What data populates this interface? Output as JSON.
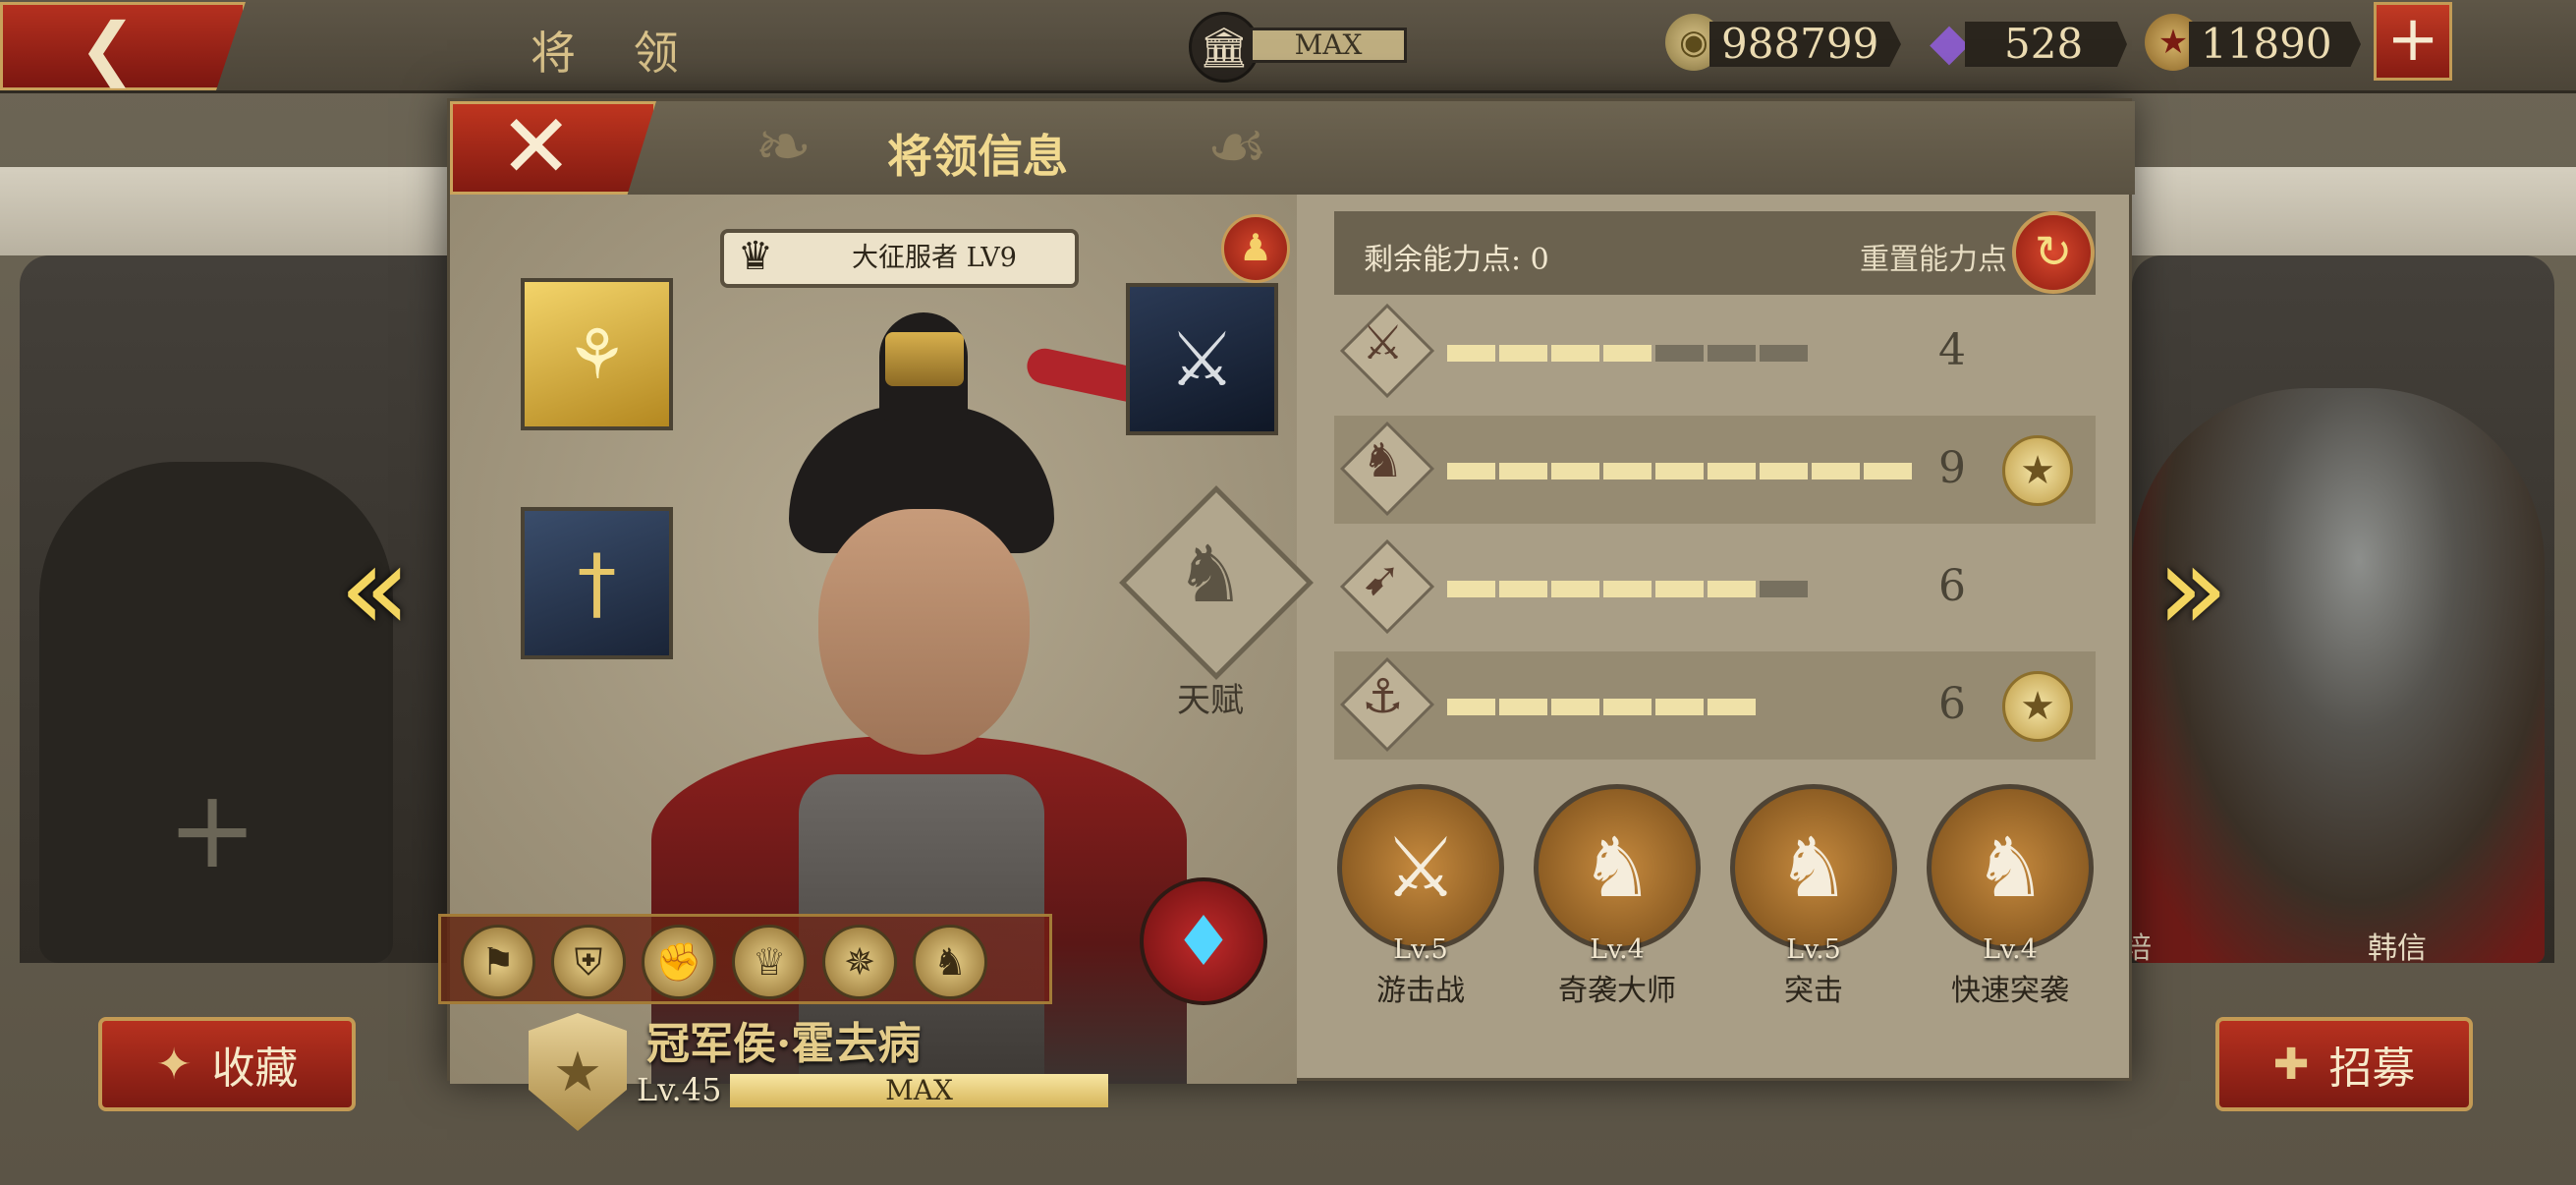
{
  "topbar": {
    "title": "将 领",
    "max_label": "MAX",
    "silver": "988799",
    "gems": "528",
    "tickets": "11890"
  },
  "modal": {
    "title": "将领信息",
    "rank_badge": "大征服者 LV9",
    "talent_label": "天赋",
    "hero_name": "冠军侯·霍去病",
    "level": "Lv.45",
    "level_bar": "MAX",
    "level_progress": 1.0
  },
  "stats": {
    "remaining_label": "剩余能力点: 0",
    "reset_label": "重置能力点",
    "rows": [
      {
        "icon": "sword-icon",
        "value": "4",
        "filled": 4,
        "total": 7,
        "medal": false
      },
      {
        "icon": "horse-icon",
        "value": "9",
        "filled": 9,
        "total": 9,
        "medal": true
      },
      {
        "icon": "bow-icon",
        "value": "6",
        "filled": 6,
        "total": 7,
        "medal": false
      },
      {
        "icon": "anchor-icon",
        "value": "6",
        "filled": 6,
        "total": 6,
        "medal": true
      }
    ]
  },
  "skills": [
    {
      "level": "Lv.5",
      "name": "游击战"
    },
    {
      "level": "Lv.4",
      "name": "奇袭大师"
    },
    {
      "level": "Lv.5",
      "name": "突击"
    },
    {
      "level": "Lv.4",
      "name": "快速突袭"
    }
  ],
  "side": {
    "right_hero_name": "韩信",
    "right_hero_name2": "培"
  },
  "buttons": {
    "collect": "收藏",
    "recruit": "招募"
  },
  "colors": {
    "accent_red": "#b5301f",
    "gold": "#f1d98f",
    "panel": "#a99e86"
  }
}
